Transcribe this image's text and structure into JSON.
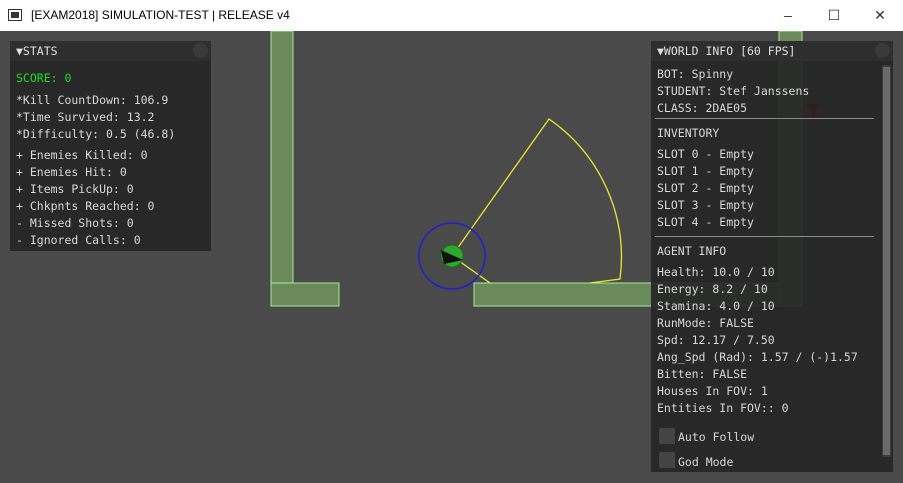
{
  "window": {
    "title": "[EXAM2018] SIMULATION-TEST | RELEASE v4",
    "minimize_glyph": "–",
    "maximize_glyph": "☐",
    "close_glyph": "✕"
  },
  "stats": {
    "header": "▼STATS",
    "score": "SCORE: 0",
    "kill_countdown": "*Kill CountDown: 106.9",
    "time_survived": "*Time Survived: 13.2",
    "difficulty": "*Difficulty: 0.5 (46.8)",
    "enemies_killed": "+ Enemies Killed: 0",
    "enemies_hit": "+ Enemies Hit: 0",
    "items_pickup": "+ Items PickUp: 0",
    "chkpnts_reached": "+ Chkpnts Reached: 0",
    "missed_shots": "- Missed Shots: 0",
    "ignored_calls": "- Ignored Calls: 0"
  },
  "world_info": {
    "header": "▼WORLD INFO [60 FPS]",
    "bot": "BOT: Spinny",
    "student": "STUDENT: Stef Janssens",
    "class": "CLASS: 2DAE05",
    "inventory_title": "INVENTORY",
    "slots": [
      "SLOT 0 - Empty",
      "SLOT 1 - Empty",
      "SLOT 2 - Empty",
      "SLOT 3 - Empty",
      "SLOT 4 - Empty"
    ],
    "agent_info_title": "AGENT INFO",
    "health": "Health: 10.0 / 10",
    "energy": "Energy: 8.2 / 10",
    "stamina": "Stamina: 4.0 / 10",
    "run_mode": "RunMode: FALSE",
    "speed": "Spd: 12.17 / 7.50",
    "ang_speed": "Ang_Spd (Rad): 1.57 / (-)1.57",
    "bitten": "Bitten: FALSE",
    "houses_in_fov": "Houses In FOV: 1",
    "entities_in_fov": "Entities In FOV:: 0",
    "auto_follow": "Auto Follow",
    "god_mode": "God Mode"
  },
  "colors": {
    "background": "#4a4a4a",
    "wall_fill": "#6a8a5c",
    "wall_stroke": "#a8e89a",
    "score": "#22dd22",
    "fov_cone": "#e8e830",
    "agent_circle": "#2020d0",
    "agent_body": "#2ea82e",
    "enemy": "#b00000"
  }
}
